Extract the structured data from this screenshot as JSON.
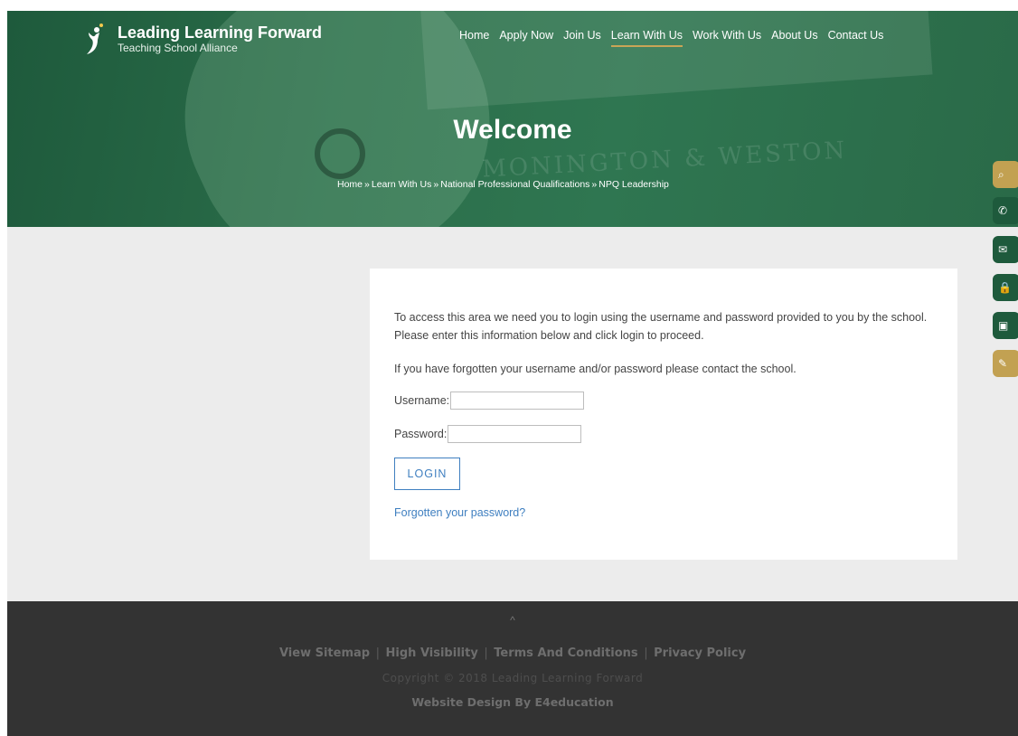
{
  "brand": {
    "title": "Leading Learning Forward",
    "subtitle": "Teaching School Alliance"
  },
  "nav": {
    "items": [
      {
        "label": "Home"
      },
      {
        "label": "Apply Now"
      },
      {
        "label": "Join Us"
      },
      {
        "label": "Learn With Us",
        "active": true
      },
      {
        "label": "Work With Us"
      },
      {
        "label": "About Us"
      },
      {
        "label": "Contact Us"
      }
    ]
  },
  "hero": {
    "title": "Welcome",
    "stamp": "MONINGTON & WESTON",
    "breadcrumb": {
      "items": [
        "Home",
        "Learn With Us",
        "National Professional Qualifications",
        "NPQ Leadership"
      ],
      "separator": "»"
    }
  },
  "side_buttons": [
    {
      "icon": "search-icon",
      "color": "#c2a152",
      "glyph": "⌕"
    },
    {
      "icon": "phone-icon",
      "color": "#1e5a3c",
      "glyph": "✆"
    },
    {
      "icon": "email-icon",
      "color": "#1e5a3c",
      "glyph": "✉"
    },
    {
      "icon": "lock-icon",
      "color": "#1e5a3c",
      "glyph": "🔒"
    },
    {
      "icon": "calendar-icon",
      "color": "#1e5a3c",
      "glyph": "▣"
    },
    {
      "icon": "pencil-icon",
      "color": "#c2a152",
      "glyph": "✎"
    }
  ],
  "login": {
    "intro": "To access this area we need you to login using the username and password provided to you by the school. Please enter this information below and click login to proceed.",
    "forgot_note": "If you have forgotten your username and/or password please contact the school.",
    "username_label": "Username:",
    "username_value": "",
    "password_label": "Password:",
    "password_value": "",
    "login_button": "LOGIN",
    "forgot_link": "Forgotten your password?"
  },
  "footer": {
    "up_arrow": "^",
    "links": [
      "View Sitemap",
      "High Visibility",
      "Terms And Conditions",
      "Privacy Policy"
    ],
    "separator": "|",
    "copyright": "Copyright © 2018 Leading Learning Forward",
    "design": "Website Design By E4education"
  },
  "colors": {
    "hero_green": "#2b6e4a",
    "accent_gold": "#c2a152",
    "link_blue": "#3f7fc0",
    "footer_bg": "#333333"
  }
}
